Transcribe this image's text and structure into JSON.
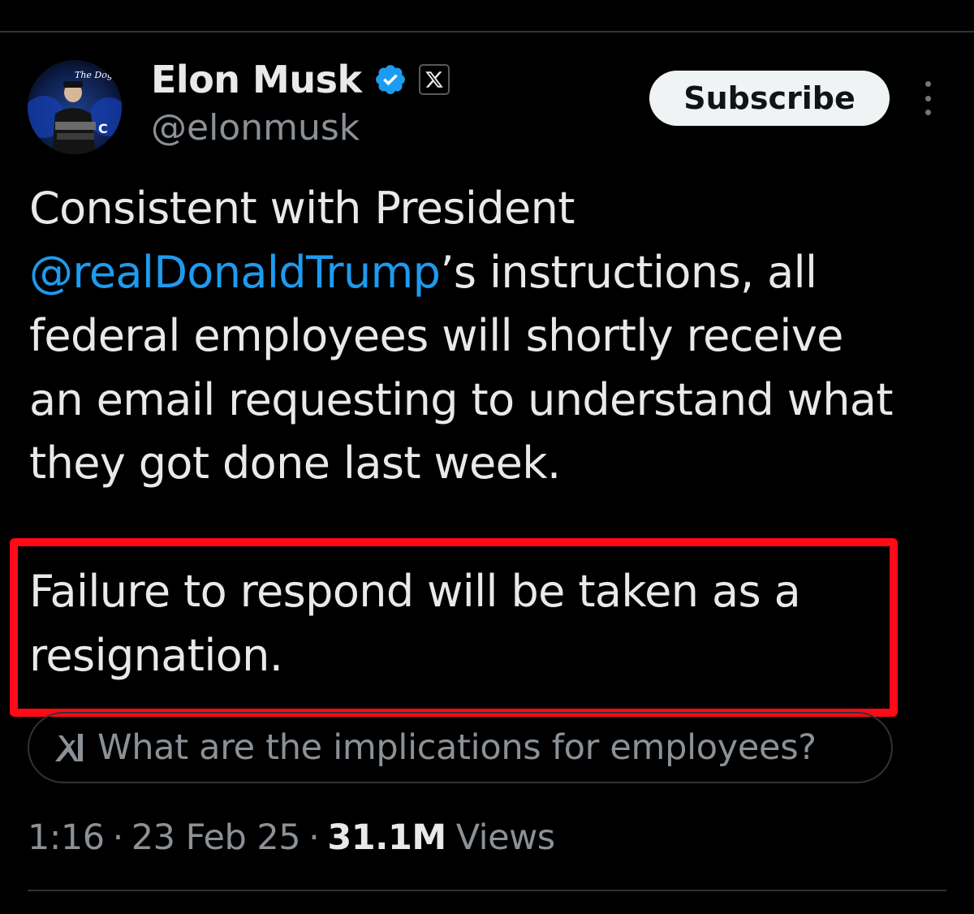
{
  "author": {
    "display_name": "Elon Musk",
    "handle": "@elonmusk",
    "avatar_text": "The Dogefa",
    "avatar_letter": "C",
    "verified_color": "#1d9bf0"
  },
  "actions": {
    "subscribe_label": "Subscribe"
  },
  "tweet": {
    "line1": "Consistent with President",
    "mention": "@realDonaldTrump",
    "line2_rest": "’s instructions, all",
    "line3": "federal employees will shortly receive",
    "line4": "an email requesting to understand what",
    "line5": "they got done last week.",
    "highlight_line1": "Failure to respond will be taken as a",
    "highlight_line2": "resignation.",
    "highlight_color": "#ff0a16",
    "mention_color": "#1d9bf0"
  },
  "grok_prompt": {
    "label": "What are the implications for employees?"
  },
  "meta": {
    "time": "1:16",
    "separator": "·",
    "date": "23 Feb 25",
    "views_count": "31.1M",
    "views_label": "Views"
  }
}
